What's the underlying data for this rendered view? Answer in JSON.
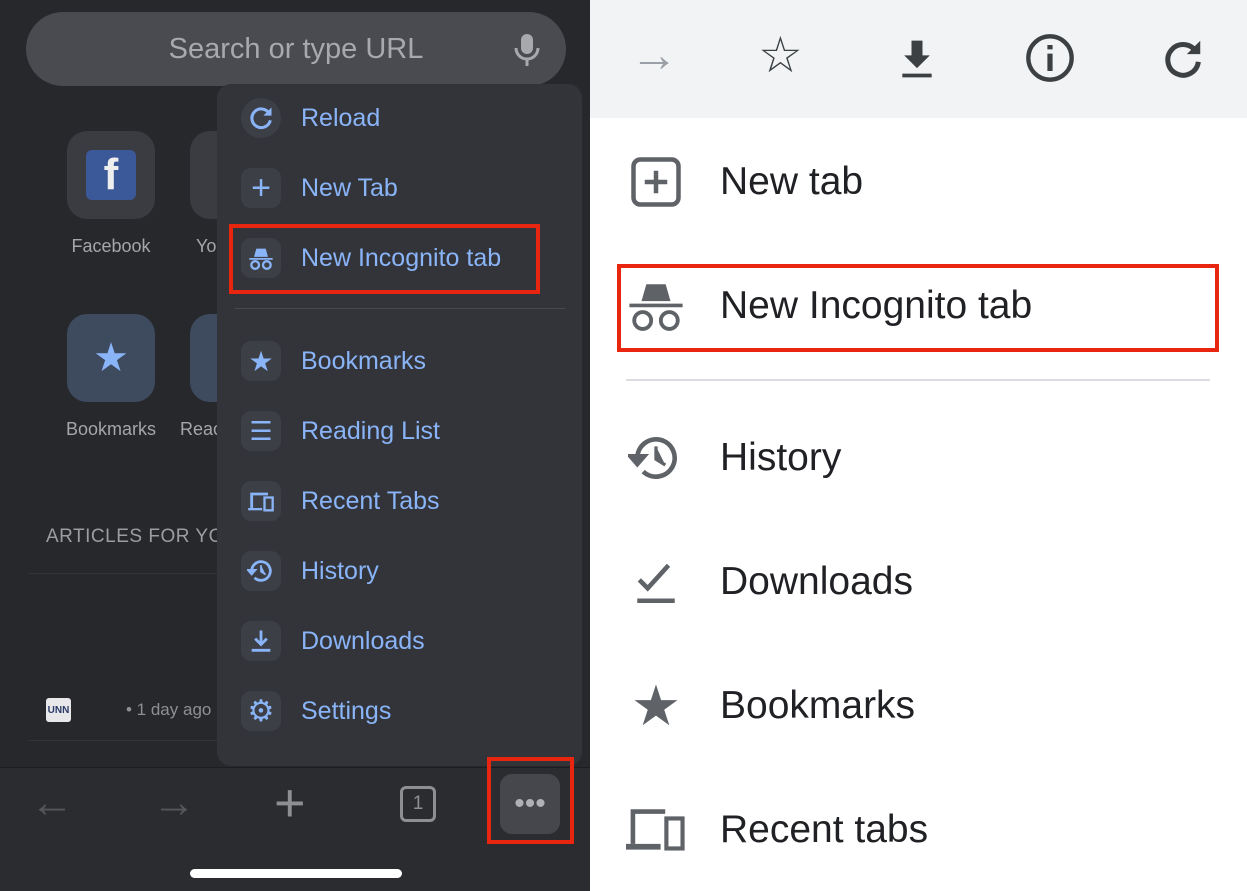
{
  "left": {
    "search_placeholder": "Search or type URL",
    "shortcuts": [
      {
        "label": "Facebook"
      },
      {
        "label": "Yo"
      },
      {
        "label": "Bookmarks"
      },
      {
        "label": "Reac"
      }
    ],
    "articles_header": "ARTICLES FOR YO",
    "article": {
      "source_logo": "UNN",
      "time": "• 1 day ago"
    },
    "menu": {
      "items": [
        {
          "label": "Reload",
          "icon": "reload-icon"
        },
        {
          "label": "New Tab",
          "icon": "plus-icon"
        },
        {
          "label": "New Incognito tab",
          "icon": "incognito-icon",
          "highlighted": true
        },
        {
          "label": "Bookmarks",
          "icon": "star-icon"
        },
        {
          "label": "Reading List",
          "icon": "list-icon"
        },
        {
          "label": "Recent Tabs",
          "icon": "devices-icon"
        },
        {
          "label": "History",
          "icon": "history-icon"
        },
        {
          "label": "Downloads",
          "icon": "download-icon"
        },
        {
          "label": "Settings",
          "icon": "gear-icon"
        }
      ]
    },
    "toolbar": {
      "tab_count": "1"
    }
  },
  "right": {
    "toolbar": [
      "forward-icon",
      "star-icon",
      "download-icon",
      "info-icon",
      "reload-icon"
    ],
    "items": [
      {
        "label": "New tab",
        "icon": "new-tab-icon"
      },
      {
        "label": "New Incognito tab",
        "icon": "incognito-icon",
        "highlighted": true
      },
      {
        "label": "History",
        "icon": "history-icon"
      },
      {
        "label": "Downloads",
        "icon": "downloads-icon"
      },
      {
        "label": "Bookmarks",
        "icon": "star-icon"
      },
      {
        "label": "Recent tabs",
        "icon": "devices-icon"
      }
    ]
  },
  "colors": {
    "accent": "#8ab4f8",
    "highlight": "#e8260f",
    "dark_bg": "#27282c"
  }
}
